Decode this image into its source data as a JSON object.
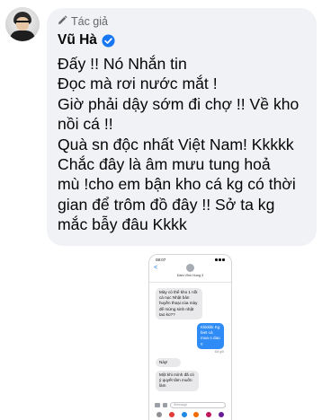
{
  "post": {
    "author_badge": "Tác giả",
    "author_name": "Vũ Hà",
    "text": "Đấy !! Nó Nhắn tin\nĐọc mà rơi nước mắt !\nGiờ phải dậy sớm đi chợ !! Về kho\nnồi cá !!\nQuà sn độc nhất Việt Nam! Kkkkk\nChắc đây là âm mưu tung hoả\nmù !cho em bận kho cá kg có thời\ngian để trôm đồ đây !! Sở ta kg\nmắc bẫy đâu Kkkk"
  },
  "screenshot": {
    "status_time": "08:07",
    "back_glyph": "<",
    "contact_name": "Đàm Vĩnh Hưng 3",
    "messages": {
      "m1": "Mày có thể kho 1 nồi cá nục Nhật bản huyền thoại của mày để mừng sinh nhật tao ko??",
      "m2": "Kkkkkk Kg biet cá mua o dau !!",
      "delivered": "Đã gửi",
      "m3": "Này!",
      "m4": "Một khi mình đã có ý quyết tâm muốn làm"
    },
    "composer_placeholder": "iMessage"
  },
  "colors": {
    "bubble_bg": "#f0f2f5",
    "verified_blue": "#1877f2",
    "imessage_blue": "#2f8cf6",
    "meta_gray": "#65676b"
  },
  "icons": {
    "author_badge_icon": "pencil-icon",
    "verified_icon": "verified-badge-icon"
  }
}
